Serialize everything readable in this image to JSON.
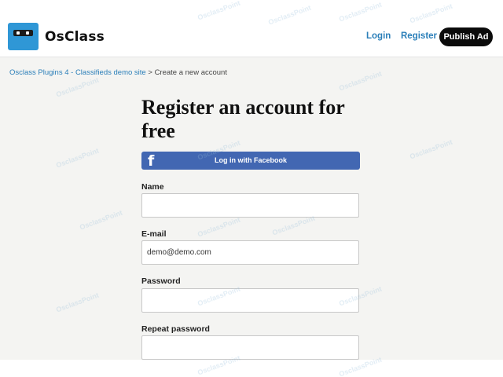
{
  "header": {
    "logo_text": "OsClass",
    "nav": {
      "login": "Login",
      "register": "Register"
    },
    "publish_label": "Publish Ad"
  },
  "breadcrumb": {
    "home": "Osclass Plugins 4 - Classifieds demo site",
    "separator": ">",
    "current": "Create a new account"
  },
  "page": {
    "title": "Register an account for free",
    "facebook_button": "Log in with Facebook",
    "facebook_icon": "f"
  },
  "form": {
    "name": {
      "label": "Name",
      "value": ""
    },
    "email": {
      "label": "E-mail",
      "value": "demo@demo.com"
    },
    "password": {
      "label": "Password",
      "value": ""
    },
    "repeat_password": {
      "label": "Repeat password",
      "value": ""
    }
  },
  "watermark_text": "OsclassPoint",
  "colors": {
    "link": "#2b7fb9",
    "facebook": "#4267b2",
    "logo": "#2f97d6",
    "publish": "#0b0b0b"
  }
}
